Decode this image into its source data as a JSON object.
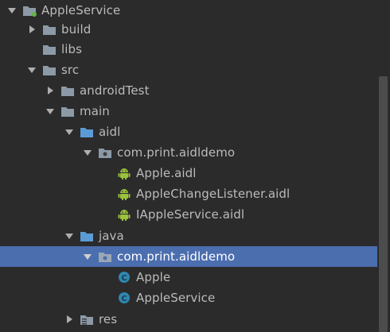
{
  "tree": {
    "items": [
      {
        "label": "AppleService",
        "icon": "module-folder-icon",
        "expanded": true
      },
      {
        "label": "build",
        "icon": "folder-icon",
        "expanded": false
      },
      {
        "label": "libs",
        "icon": "folder-icon"
      },
      {
        "label": "src",
        "icon": "folder-icon",
        "expanded": true
      },
      {
        "label": "androidTest",
        "icon": "folder-icon",
        "expanded": false
      },
      {
        "label": "main",
        "icon": "folder-icon",
        "expanded": true
      },
      {
        "label": "aidl",
        "icon": "source-folder-icon",
        "expanded": true
      },
      {
        "label": "com.print.aidldemo",
        "icon": "package-icon",
        "expanded": true
      },
      {
        "label": "Apple.aidl",
        "icon": "android-icon"
      },
      {
        "label": "AppleChangeListener.aidl",
        "icon": "android-icon"
      },
      {
        "label": "IAppleService.aidl",
        "icon": "android-icon"
      },
      {
        "label": "java",
        "icon": "source-folder-icon",
        "expanded": true
      },
      {
        "label": "com.print.aidldemo",
        "icon": "package-icon",
        "expanded": true,
        "selected": true
      },
      {
        "label": "Apple",
        "icon": "class-icon"
      },
      {
        "label": "AppleService",
        "icon": "class-icon"
      },
      {
        "label": "res",
        "icon": "resource-folder-icon",
        "expanded": false
      }
    ]
  },
  "colors": {
    "background": "#2b2b2b",
    "selection": "#4b6eaf",
    "text": "#bbbbbb",
    "folder": "#8b9aa6",
    "source_folder": "#5b9bd5",
    "android": "#9ac23c",
    "class": "#2f87b0"
  }
}
